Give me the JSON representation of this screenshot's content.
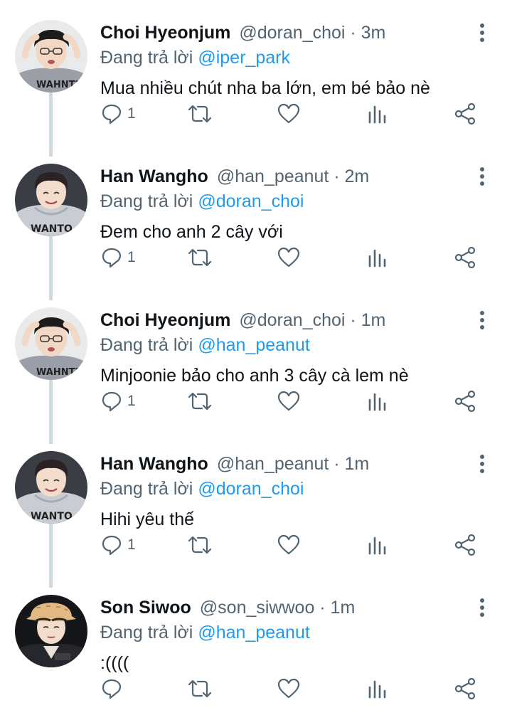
{
  "colors": {
    "text": "#0f1419",
    "secondary": "#536471",
    "accent": "#1d9bf0",
    "thread_line": "#cfd9de"
  },
  "icons": {
    "reply": "reply-icon",
    "retweet": "retweet-icon",
    "like": "heart-icon",
    "views": "analytics-icon",
    "share": "share-icon",
    "more": "more-vertical-icon"
  },
  "tweets": [
    {
      "name": "Choi Hyeonjum",
      "handle_time": "@doran_choi · 3m",
      "reply_prefix": "Đang trả lời",
      "mention": "@iper_park",
      "text": "Mua nhiều chút nha ba lớn, em bé bảo nè",
      "reply_count": "1",
      "avatar": "glasses-boy-avatar"
    },
    {
      "name": "Han Wangho",
      "handle_time": "@han_peanut · 2m",
      "reply_prefix": "Đang trả lời",
      "mention": "@doran_choi",
      "text": "Đem cho anh 2 cây với",
      "reply_count": "1",
      "avatar": "hoodie-boy-avatar"
    },
    {
      "name": "Choi Hyeonjum",
      "handle_time": "@doran_choi · 1m",
      "reply_prefix": "Đang trả lời",
      "mention": "@han_peanut",
      "text": "Minjoonie bảo cho anh 3 cây cà lem nè",
      "reply_count": "1",
      "avatar": "glasses-boy-avatar"
    },
    {
      "name": "Han Wangho",
      "handle_time": "@han_peanut · 1m",
      "reply_prefix": "Đang trả lời",
      "mention": "@doran_choi",
      "text": "Hihi yêu thế",
      "reply_count": "1",
      "avatar": "hoodie-boy-avatar"
    },
    {
      "name": "Son Siwoo",
      "handle_time": "@son_siwwoo · 1m",
      "reply_prefix": "Đang trả lời",
      "mention": "@han_peanut",
      "text": ":((((",
      "reply_count": "",
      "avatar": "bucket-hat-boy-avatar"
    }
  ]
}
